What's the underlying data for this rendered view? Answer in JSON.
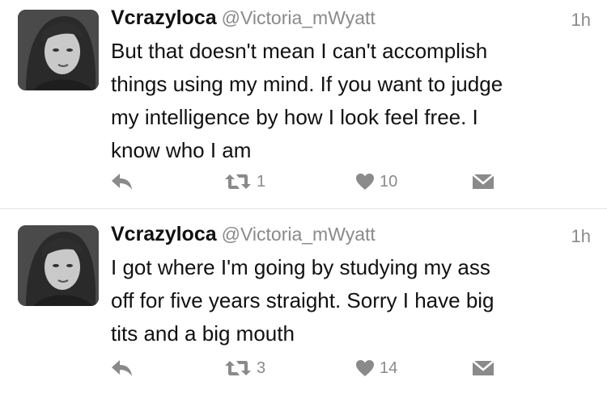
{
  "tweets": [
    {
      "display_name": "Vcrazyloca",
      "handle": "@Victoria_mWyatt",
      "time": "1h",
      "lines": [
        "But that doesn't mean I can't accomplish",
        "things using my mind. If you want to judge",
        "my intelligence by how I look feel free. I",
        "know who I am"
      ],
      "retweets": "1",
      "likes": "10"
    },
    {
      "display_name": "Vcrazyloca",
      "handle": "@Victoria_mWyatt",
      "time": "1h",
      "lines": [
        "I got where I'm going by studying my ass",
        "off for five years straight. Sorry I have big",
        "tits and a big mouth"
      ],
      "retweets": "3",
      "likes": "14"
    }
  ],
  "icons": {
    "reply": "reply-icon",
    "retweet": "retweet-icon",
    "like": "heart-icon",
    "dm": "direct-message-icon"
  },
  "colors": {
    "text": "#111111",
    "secondary": "#8a8a8a",
    "divider": "#e4e4e4",
    "background": "#ffffff"
  }
}
